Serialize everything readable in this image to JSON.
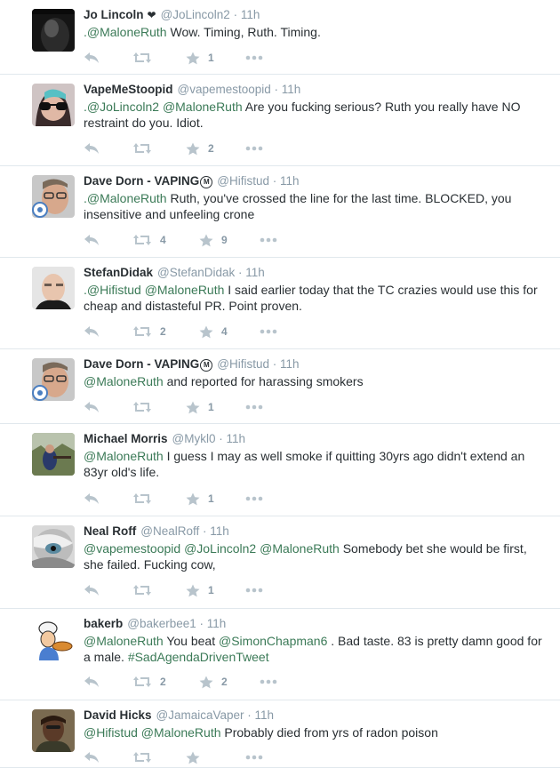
{
  "colors": {
    "link": "#3b7a57",
    "muted": "#8899a6",
    "text": "#292f33",
    "divider": "#e1e8ed"
  },
  "tweets": [
    {
      "name": "Jo Lincoln",
      "name_suffix": "❤",
      "handle": "@JoLincoln2",
      "time": "11h",
      "text_segments": [
        {
          "t": ".@MaloneRuth",
          "m": true
        },
        {
          "t": " Wow. Timing, Ruth. Timing.",
          "m": false
        }
      ],
      "retweets": "",
      "likes": "1"
    },
    {
      "name": "VapeMeStoopid",
      "name_suffix": "",
      "handle": "@vapemestoopid",
      "time": "11h",
      "text_segments": [
        {
          "t": ".@JoLincoln2",
          "m": true
        },
        {
          "t": " ",
          "m": false
        },
        {
          "t": "@MaloneRuth",
          "m": true
        },
        {
          "t": " Are you fucking serious? Ruth you really have NO restraint do you. Idiot.",
          "m": false
        }
      ],
      "retweets": "",
      "likes": "2"
    },
    {
      "name": "Dave Dorn - VAPING",
      "name_suffix": "M",
      "handle": "@Hifistud",
      "time": "11h",
      "text_segments": [
        {
          "t": ".@MaloneRuth",
          "m": true
        },
        {
          "t": " Ruth, you've crossed the line for the last time. BLOCKED, you insensitive and unfeeling crone",
          "m": false
        }
      ],
      "retweets": "4",
      "likes": "9"
    },
    {
      "name": "StefanDidak",
      "name_suffix": "",
      "handle": "@StefanDidak",
      "time": "11h",
      "text_segments": [
        {
          "t": ".@Hifistud",
          "m": true
        },
        {
          "t": " ",
          "m": false
        },
        {
          "t": "@MaloneRuth",
          "m": true
        },
        {
          "t": " I said earlier today that the TC crazies would use this for cheap and distasteful PR. Point proven.",
          "m": false
        }
      ],
      "retweets": "2",
      "likes": "4"
    },
    {
      "name": "Dave Dorn - VAPING",
      "name_suffix": "M",
      "handle": "@Hifistud",
      "time": "11h",
      "text_segments": [
        {
          "t": "@MaloneRuth",
          "m": true
        },
        {
          "t": " and reported for harassing smokers",
          "m": false
        }
      ],
      "retweets": "",
      "likes": "1"
    },
    {
      "name": "Michael Morris",
      "name_suffix": "",
      "handle": "@Mykl0",
      "time": "11h",
      "text_segments": [
        {
          "t": "@MaloneRuth",
          "m": true
        },
        {
          "t": " I guess I may as well smoke if quitting 30yrs ago didn't extend an 83yr old's life.",
          "m": false
        }
      ],
      "retweets": "",
      "likes": "1"
    },
    {
      "name": "Neal Roff",
      "name_suffix": "",
      "handle": "@NealRoff",
      "time": "11h",
      "text_segments": [
        {
          "t": "@vapemestoopid",
          "m": true
        },
        {
          "t": " ",
          "m": false
        },
        {
          "t": "@JoLincoln2",
          "m": true
        },
        {
          "t": " ",
          "m": false
        },
        {
          "t": "@MaloneRuth",
          "m": true
        },
        {
          "t": " Somebody bet she would be first, she failed. Fucking cow,",
          "m": false
        }
      ],
      "retweets": "",
      "likes": "1"
    },
    {
      "name": "bakerb",
      "name_suffix": "",
      "handle": "@bakerbee1",
      "time": "11h",
      "text_segments": [
        {
          "t": "@MaloneRuth",
          "m": true
        },
        {
          "t": " You beat ",
          "m": false
        },
        {
          "t": "@SimonChapman6",
          "m": true
        },
        {
          "t": " . Bad taste. 83 is pretty damn good for  a male. ",
          "m": false
        },
        {
          "t": "#SadAgendaDrivenTweet",
          "m": true
        }
      ],
      "retweets": "2",
      "likes": "2"
    },
    {
      "name": "David Hicks",
      "name_suffix": "",
      "handle": "@JamaicaVaper",
      "time": "11h",
      "text_segments": [
        {
          "t": "@Hifistud",
          "m": true
        },
        {
          "t": " ",
          "m": false
        },
        {
          "t": "@MaloneRuth",
          "m": true
        },
        {
          "t": " Probably died from yrs of radon poison",
          "m": false
        }
      ],
      "retweets": "",
      "likes": ""
    }
  ]
}
